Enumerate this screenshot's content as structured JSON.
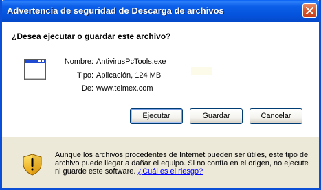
{
  "window": {
    "title": "Advertencia de seguridad de Descarga de archivos"
  },
  "dialog": {
    "question": "¿Desea ejecutar o guardar este archivo?",
    "file": {
      "name_label": "Nombre:",
      "name_value": "AntivirusPcTools.exe",
      "type_label": "Tipo:",
      "type_value": "Aplicación, 124 MB",
      "from_label": "De:",
      "from_value": "www.telmex.com"
    },
    "buttons": {
      "run_pre": "",
      "run_mnemonic": "E",
      "run_post": "jecutar",
      "save_pre": "",
      "save_mnemonic": "G",
      "save_post": "uardar",
      "cancel": "Cancelar"
    },
    "warning": {
      "text": "Aunque los archivos procedentes de Internet pueden ser útiles, este tipo de archivo puede llegar a dañar el equipo. Si no confía en el origen, no ejecute ni guarde este software.",
      "link": "¿Cuál es el riesgo?"
    }
  },
  "icons": {
    "close": "close-icon",
    "file": "application-window-icon",
    "warning": "security-shield-icon"
  },
  "colors": {
    "titlebar": "#0553dc",
    "close_button": "#d9592e",
    "link": "#0000ff",
    "background": "#ece9d8"
  }
}
